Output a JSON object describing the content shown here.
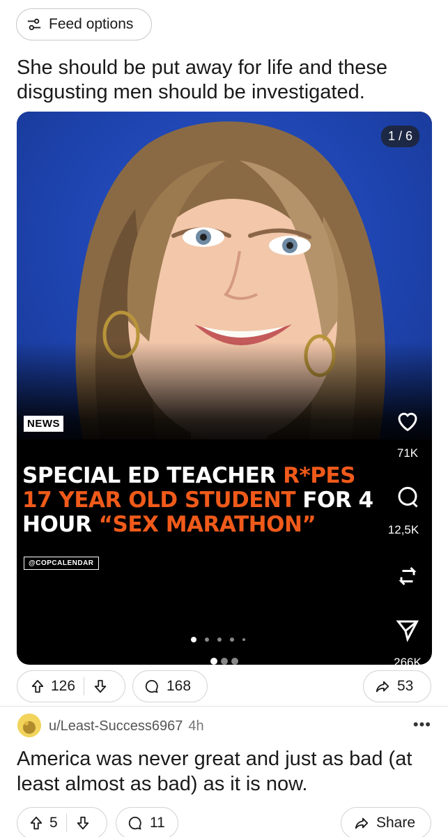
{
  "feed_options": {
    "label": "Feed options",
    "icon": "sliders-icon"
  },
  "post": {
    "title": "She should be put away for life and these disgusting men should be investigated.",
    "media": {
      "counter": "1 / 6",
      "tag": "NEWS",
      "headline": {
        "w1": "SPECIAL ED TEACHER ",
        "o1": "R*PES",
        "o2": "17 YEAR OLD STUDENT",
        "w2": " FOR 4",
        "w3": "HOUR ",
        "o3": "“SEX MARATHON”"
      },
      "handle": "@COPCALENDAR",
      "likes": "71K",
      "comments": "12,5K",
      "shares": "266K"
    },
    "actions": {
      "upvotes": "126",
      "comments": "168",
      "shares": "53"
    }
  },
  "comment": {
    "username": "u/Least-Success6967",
    "time": "4h",
    "more": "•••",
    "text": "America was never great and just as bad (at least almost as bad) as it is now.",
    "upvotes": "5",
    "replies": "11",
    "share_label": "Share"
  },
  "colors": {
    "headline_orange": "#f05a1a",
    "photo_blue": "#1e44b0"
  }
}
